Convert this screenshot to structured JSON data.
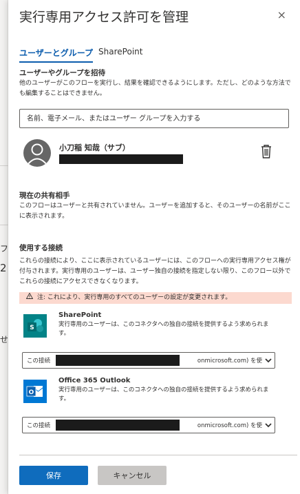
{
  "background": {
    "fragments": [
      "フ",
      "2",
      "せ"
    ]
  },
  "panel": {
    "title": "実行専用アクセス許可を管理",
    "close_glyph": "×"
  },
  "tabs": [
    {
      "label": "ユーザーとグループ",
      "active": true
    },
    {
      "label": "SharePoint",
      "active": false
    }
  ],
  "invite": {
    "heading": "ユーザーやグループを招待",
    "description": "他のユーザーがこのフローを実行し、結果を確認できるようにします。ただし、どのような方法でも編集することはできません。",
    "placeholder": "名前、電子メール、またはユーザー グループを入力する"
  },
  "user": {
    "name": "小刀稲 知哉（サブ）"
  },
  "shared": {
    "heading": "現在の共有相手",
    "description": "このフローはユーザーと共有されていません。ユーザーを追加すると、そのユーザーの名前がここに表示されます。"
  },
  "connections": {
    "heading": "使用する接続",
    "description": "これらの接続により、ここに表示されているユーザーには、このフローへの実行専用アクセス権が付与されます。実行専用のユーザーは、ユーザー独自の接続を指定しない限り、このフロー以外でこれらの接続にアクセスできなくなります。",
    "warning": "注: これにより、実行専用のすべてのユーザーの設定が変更されます。",
    "items": [
      {
        "name": "SharePoint",
        "description": "実行専用のユーザーは、このコネクタへの独自の接続を提供するよう求められます。",
        "select_prefix": "この接続",
        "select_suffix": "onmicrosoft.com) を使",
        "icon": "sharepoint-icon",
        "color": "#038387"
      },
      {
        "name": "Office 365 Outlook",
        "description": "実行専用のユーザーは、このコネクタへの独自の接続を提供するよう求められます。",
        "select_prefix": "この接続",
        "select_suffix": "onmicrosoft.com) を使",
        "icon": "outlook-icon",
        "color": "#0078d4"
      }
    ]
  },
  "footer": {
    "save_label": "保存",
    "cancel_label": "キャンセル"
  },
  "colors": {
    "accent": "#0b5cad",
    "primary_button": "#0f6cbd",
    "warning_bg": "#fcd9cf"
  }
}
